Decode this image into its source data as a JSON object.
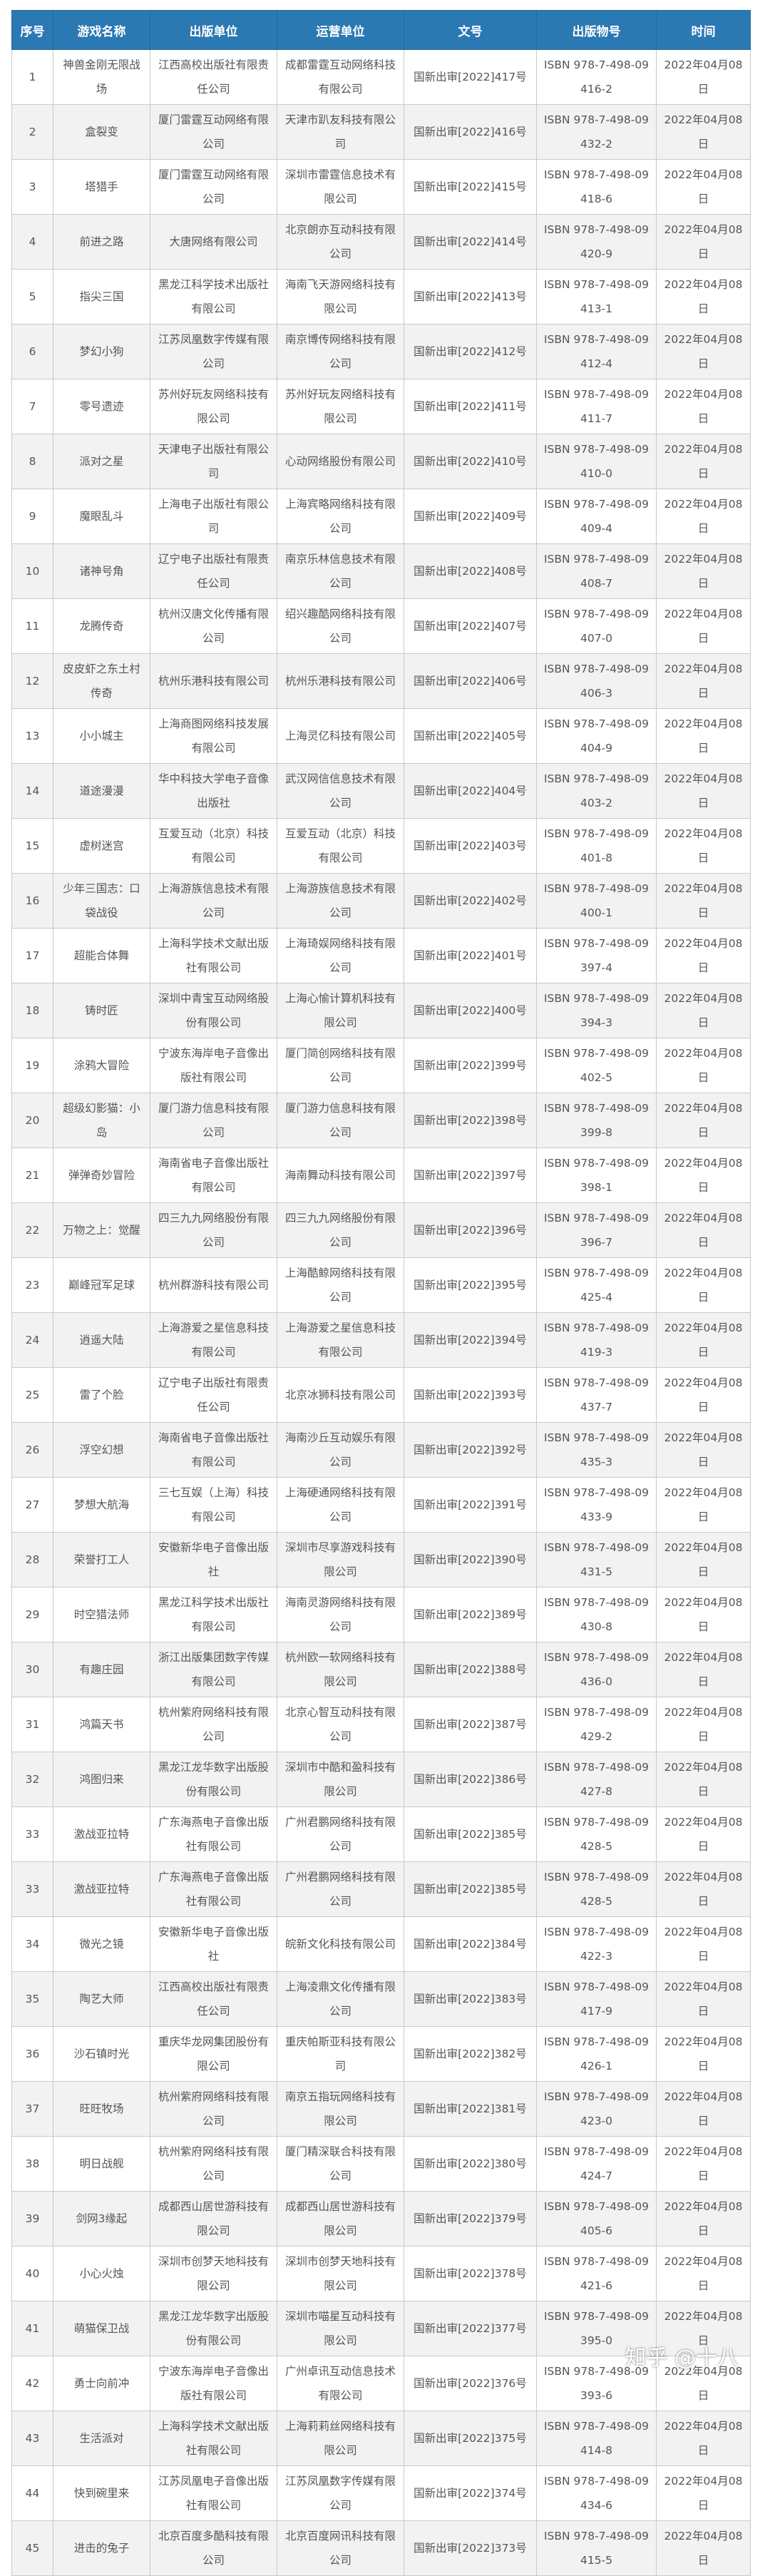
{
  "headers": [
    "序号",
    "游戏名称",
    "出版单位",
    "运营单位",
    "文号",
    "出版物号",
    "时间"
  ],
  "rows": [
    [
      "1",
      "神兽金刚无限战场",
      "江西高校出版社有限责任公司",
      "成都雷霆互动网络科技有限公司",
      "国新出审[2022]417号",
      "ISBN 978-7-498-09416-2",
      "2022年04月08日"
    ],
    [
      "2",
      "盒裂变",
      "厦门雷霆互动网络有限公司",
      "天津市趴友科技有限公司",
      "国新出审[2022]416号",
      "ISBN 978-7-498-09432-2",
      "2022年04月08日"
    ],
    [
      "3",
      "塔猎手",
      "厦门雷霆互动网络有限公司",
      "深圳市雷霆信息技术有限公司",
      "国新出审[2022]415号",
      "ISBN 978-7-498-09418-6",
      "2022年04月08日"
    ],
    [
      "4",
      "前进之路",
      "大唐网络有限公司",
      "北京朗亦互动科技有限公司",
      "国新出审[2022]414号",
      "ISBN 978-7-498-09420-9",
      "2022年04月08日"
    ],
    [
      "5",
      "指尖三国",
      "黑龙江科学技术出版社有限公司",
      "海南飞天游网络科技有限公司",
      "国新出审[2022]413号",
      "ISBN 978-7-498-09413-1",
      "2022年04月08日"
    ],
    [
      "6",
      "梦幻小狗",
      "江苏凤凰数字传媒有限公司",
      "南京博传网络科技有限公司",
      "国新出审[2022]412号",
      "ISBN 978-7-498-09412-4",
      "2022年04月08日"
    ],
    [
      "7",
      "零号遗迹",
      "苏州好玩友网络科技有限公司",
      "苏州好玩友网络科技有限公司",
      "国新出审[2022]411号",
      "ISBN 978-7-498-09411-7",
      "2022年04月08日"
    ],
    [
      "8",
      "派对之星",
      "天津电子出版社有限公司",
      "心动网络股份有限公司",
      "国新出审[2022]410号",
      "ISBN 978-7-498-09410-0",
      "2022年04月08日"
    ],
    [
      "9",
      "魔眼乱斗",
      "上海电子出版社有限公司",
      "上海宾略网络科技有限公司",
      "国新出审[2022]409号",
      "ISBN 978-7-498-09409-4",
      "2022年04月08日"
    ],
    [
      "10",
      "诸神号角",
      "辽宁电子出版社有限责任公司",
      "南京乐林信息技术有限公司",
      "国新出审[2022]408号",
      "ISBN 978-7-498-09408-7",
      "2022年04月08日"
    ],
    [
      "11",
      "龙腾传奇",
      "杭州汉唐文化传播有限公司",
      "绍兴趣酷网络科技有限公司",
      "国新出审[2022]407号",
      "ISBN 978-7-498-09407-0",
      "2022年04月08日"
    ],
    [
      "12",
      "皮皮虾之东土村传奇",
      "杭州乐港科技有限公司",
      "杭州乐港科技有限公司",
      "国新出审[2022]406号",
      "ISBN 978-7-498-09406-3",
      "2022年04月08日"
    ],
    [
      "13",
      "小小城主",
      "上海商图网络科技发展有限公司",
      "上海灵亿科技有限公司",
      "国新出审[2022]405号",
      "ISBN 978-7-498-09404-9",
      "2022年04月08日"
    ],
    [
      "14",
      "道途漫漫",
      "华中科技大学电子音像出版社",
      "武汉网信信息技术有限公司",
      "国新出审[2022]404号",
      "ISBN 978-7-498-09403-2",
      "2022年04月08日"
    ],
    [
      "15",
      "虚树迷宫",
      "互爱互动（北京）科技有限公司",
      "互爱互动（北京）科技有限公司",
      "国新出审[2022]403号",
      "ISBN 978-7-498-09401-8",
      "2022年04月08日"
    ],
    [
      "16",
      "少年三国志：口袋战役",
      "上海游族信息技术有限公司",
      "上海游族信息技术有限公司",
      "国新出审[2022]402号",
      "ISBN 978-7-498-09400-1",
      "2022年04月08日"
    ],
    [
      "17",
      "超能合体舞",
      "上海科学技术文献出版社有限公司",
      "上海琦娱网络科技有限公司",
      "国新出审[2022]401号",
      "ISBN 978-7-498-09397-4",
      "2022年04月08日"
    ],
    [
      "18",
      "铸时匠",
      "深圳中青宝互动网络股份有限公司",
      "上海心愉计算机科技有限公司",
      "国新出审[2022]400号",
      "ISBN 978-7-498-09394-3",
      "2022年04月08日"
    ],
    [
      "19",
      "涂鸦大冒险",
      "宁波东海岸电子音像出版社有限公司",
      "厦门简创网络科技有限公司",
      "国新出审[2022]399号",
      "ISBN 978-7-498-09402-5",
      "2022年04月08日"
    ],
    [
      "20",
      "超级幻影猫：小岛",
      "厦门游力信息科技有限公司",
      "厦门游力信息科技有限公司",
      "国新出审[2022]398号",
      "ISBN 978-7-498-09399-8",
      "2022年04月08日"
    ],
    [
      "21",
      "弹弹奇妙冒险",
      "海南省电子音像出版社有限公司",
      "海南舞动科技有限公司",
      "国新出审[2022]397号",
      "ISBN 978-7-498-09398-1",
      "2022年04月08日"
    ],
    [
      "22",
      "万物之上：觉醒",
      "四三九九网络股份有限公司",
      "四三九九网络股份有限公司",
      "国新出审[2022]396号",
      "ISBN 978-7-498-09396-7",
      "2022年04月08日"
    ],
    [
      "23",
      "巅峰冠军足球",
      "杭州群游科技有限公司",
      "上海酷鲸网络科技有限公司",
      "国新出审[2022]395号",
      "ISBN 978-7-498-09425-4",
      "2022年04月08日"
    ],
    [
      "24",
      "逍遥大陆",
      "上海游爱之星信息科技有限公司",
      "上海游爱之星信息科技有限公司",
      "国新出审[2022]394号",
      "ISBN 978-7-498-09419-3",
      "2022年04月08日"
    ],
    [
      "25",
      "雷了个脸",
      "辽宁电子出版社有限责任公司",
      "北京冰狮科技有限公司",
      "国新出审[2022]393号",
      "ISBN 978-7-498-09437-7",
      "2022年04月08日"
    ],
    [
      "26",
      "浮空幻想",
      "海南省电子音像出版社有限公司",
      "海南沙丘互动娱乐有限公司",
      "国新出审[2022]392号",
      "ISBN 978-7-498-09435-3",
      "2022年04月08日"
    ],
    [
      "27",
      "梦想大航海",
      "三七互娱（上海）科技有限公司",
      "上海硬通网络科技有限公司",
      "国新出审[2022]391号",
      "ISBN 978-7-498-09433-9",
      "2022年04月08日"
    ],
    [
      "28",
      "荣誉打工人",
      "安徽新华电子音像出版社",
      "深圳市尽享游戏科技有限公司",
      "国新出审[2022]390号",
      "ISBN 978-7-498-09431-5",
      "2022年04月08日"
    ],
    [
      "29",
      "时空猎法师",
      "黑龙江科学技术出版社有限公司",
      "海南灵游网络科技有限公司",
      "国新出审[2022]389号",
      "ISBN 978-7-498-09430-8",
      "2022年04月08日"
    ],
    [
      "30",
      "有趣庄园",
      "浙江出版集团数字传媒有限公司",
      "杭州欧一软网络科技有限公司",
      "国新出审[2022]388号",
      "ISBN 978-7-498-09436-0",
      "2022年04月08日"
    ],
    [
      "31",
      "鸿篇天书",
      "杭州紫府网络科技有限公司",
      "北京心智互动科技有限公司",
      "国新出审[2022]387号",
      "ISBN 978-7-498-09429-2",
      "2022年04月08日"
    ],
    [
      "32",
      "鸿图归来",
      "黑龙江龙华数字出版股份有限公司",
      "深圳市中酷和盈科技有限公司",
      "国新出审[2022]386号",
      "ISBN 978-7-498-09427-8",
      "2022年04月08日"
    ],
    [
      "33",
      "激战亚拉特",
      "广东海燕电子音像出版社有限公司",
      "广州君鹏网络科技有限公司",
      "国新出审[2022]385号",
      "ISBN 978-7-498-09428-5",
      "2022年04月08日"
    ],
    [
      "33",
      "激战亚拉特",
      "广东海燕电子音像出版社有限公司",
      "广州君鹏网络科技有限公司",
      "国新出审[2022]385号",
      "ISBN 978-7-498-09428-5",
      "2022年04月08日"
    ],
    [
      "34",
      "微光之镜",
      "安徽新华电子音像出版社",
      "皖新文化科技有限公司",
      "国新出审[2022]384号",
      "ISBN 978-7-498-09422-3",
      "2022年04月08日"
    ],
    [
      "35",
      "陶艺大师",
      "江西高校出版社有限责任公司",
      "上海凌鼎文化传播有限公司",
      "国新出审[2022]383号",
      "ISBN 978-7-498-09417-9",
      "2022年04月08日"
    ],
    [
      "36",
      "沙石镇时光",
      "重庆华龙网集团股份有限公司",
      "重庆帕斯亚科技有限公司",
      "国新出审[2022]382号",
      "ISBN 978-7-498-09426-1",
      "2022年04月08日"
    ],
    [
      "37",
      "旺旺牧场",
      "杭州紫府网络科技有限公司",
      "南京五指玩网络科技有限公司",
      "国新出审[2022]381号",
      "ISBN 978-7-498-09423-0",
      "2022年04月08日"
    ],
    [
      "38",
      "明日战舰",
      "杭州紫府网络科技有限公司",
      "厦门精深联合科技有限公司",
      "国新出审[2022]380号",
      "ISBN 978-7-498-09424-7",
      "2022年04月08日"
    ],
    [
      "39",
      "剑网3缘起",
      "成都西山居世游科技有限公司",
      "成都西山居世游科技有限公司",
      "国新出审[2022]379号",
      "ISBN 978-7-498-09405-6",
      "2022年04月08日"
    ],
    [
      "40",
      "小心火烛",
      "深圳市创梦天地科技有限公司",
      "深圳市创梦天地科技有限公司",
      "国新出审[2022]378号",
      "ISBN 978-7-498-09421-6",
      "2022年04月08日"
    ],
    [
      "41",
      "萌猫保卫战",
      "黑龙江龙华数字出版股份有限公司",
      "深圳市喵星互动科技有限公司",
      "国新出审[2022]377号",
      "ISBN 978-7-498-09395-0",
      "2022年04月08日"
    ],
    [
      "42",
      "勇士向前冲",
      "宁波东海岸电子音像出版社有限公司",
      "广州卓讯互动信息技术有限公司",
      "国新出审[2022]376号",
      "ISBN 978-7-498-09393-6",
      "2022年04月08日"
    ],
    [
      "43",
      "生活派对",
      "上海科学技术文献出版社有限公司",
      "上海莉莉丝网络科技有限公司",
      "国新出审[2022]375号",
      "ISBN 978-7-498-09414-8",
      "2022年04月08日"
    ],
    [
      "44",
      "快到碗里来",
      "江苏凤凰电子音像出版社有限公司",
      "江苏凤凰数字传媒有限公司",
      "国新出审[2022]374号",
      "ISBN 978-7-498-09434-6",
      "2022年04月08日"
    ],
    [
      "45",
      "进击的兔子",
      "北京百度多酷科技有限公司",
      "北京百度网讯科技有限公司",
      "国新出审[2022]373号",
      "ISBN 978-7-498-09415-5",
      "2022年04月08日"
    ]
  ],
  "watermark": "知乎 @十八",
  "colors": {
    "header_bg": "#2b79b3",
    "header_text": "#ffffff",
    "row_alt_bg": "#f2f2f2",
    "cell_text": "#555555",
    "border": "#c9c9c9"
  }
}
